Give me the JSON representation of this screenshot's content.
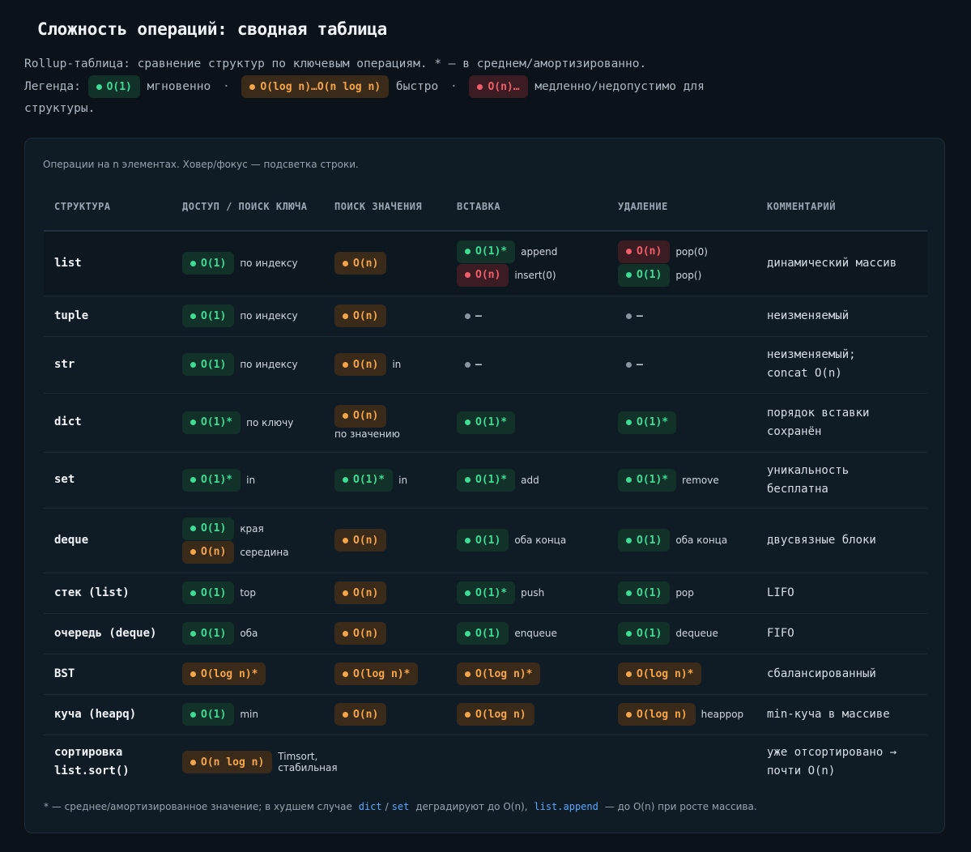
{
  "title": "Сложность операций: сводная таблица",
  "intro": {
    "line1": "Rollup-таблица: сравнение структур по ключевым операциям. * — в среднем/амортизированно.",
    "legend_label": "Легенда:",
    "legend_g": "O(1)",
    "legend_g_text": "мгновенно",
    "legend_sep": "·",
    "legend_o": "O(log n)…O(n log n)",
    "legend_o_text": "быстро",
    "legend_r": "O(n)…",
    "legend_r_text": "медленно/недопустимо для",
    "line3": "структуры."
  },
  "card": {
    "note": "Операции на n элементах. Ховер/фокус — подсветка строки.",
    "headers": [
      "СТРУКТУРА",
      "ДОСТУП / ПОИСК КЛЮЧА",
      "ПОИСК ЗНАЧЕНИЯ",
      "ВСТАВКА",
      "УДАЛЕНИЕ",
      "КОММЕНТАРИЙ"
    ],
    "rows": [
      {
        "name": "list",
        "access": [
          {
            "c": "g",
            "v": "O(1)",
            "n": "по индексу"
          }
        ],
        "search": [
          {
            "c": "o",
            "v": "O(n)",
            "n": ""
          }
        ],
        "insert": [
          {
            "c": "g",
            "v": "O(1)*",
            "n": "append"
          },
          {
            "c": "r",
            "v": "O(n)",
            "n": "insert(0)"
          }
        ],
        "delete": [
          {
            "c": "r",
            "v": "O(n)",
            "n": "pop(0)"
          },
          {
            "c": "g",
            "v": "O(1)",
            "n": "pop()"
          }
        ],
        "comment": "динамический массив",
        "h": 80
      },
      {
        "name": "tuple",
        "access": [
          {
            "c": "g",
            "v": "O(1)",
            "n": "по индексу"
          }
        ],
        "search": [
          {
            "c": "o",
            "v": "O(n)",
            "n": ""
          }
        ],
        "insert": [
          {
            "c": "n",
            "v": "—",
            "n": ""
          }
        ],
        "delete": [
          {
            "c": "n",
            "v": "—",
            "n": ""
          }
        ],
        "comment": "неизменяемый",
        "h": 50
      },
      {
        "name": "str",
        "access": [
          {
            "c": "g",
            "v": "O(1)",
            "n": "по индексу"
          }
        ],
        "search": [
          {
            "c": "o",
            "v": "O(n)",
            "n": "in"
          }
        ],
        "insert": [
          {
            "c": "n",
            "v": "—",
            "n": ""
          }
        ],
        "delete": [
          {
            "c": "n",
            "v": "—",
            "n": ""
          }
        ],
        "comment": "неизменяемый; concat O(n)",
        "h": 70
      },
      {
        "name": "dict",
        "access": [
          {
            "c": "g",
            "v": "O(1)*",
            "n": "по ключу"
          }
        ],
        "search": [
          {
            "c": "o",
            "v": "O(n)",
            "n": "по значению",
            "wrap": true
          }
        ],
        "insert": [
          {
            "c": "g",
            "v": "O(1)*",
            "n": ""
          }
        ],
        "delete": [
          {
            "c": "g",
            "v": "O(1)*",
            "n": ""
          }
        ],
        "comment": "порядок вставки сохранён",
        "h": 73
      },
      {
        "name": "set",
        "access": [
          {
            "c": "g",
            "v": "O(1)*",
            "n": "in"
          }
        ],
        "search": [
          {
            "c": "g",
            "v": "O(1)*",
            "n": "in"
          }
        ],
        "insert": [
          {
            "c": "g",
            "v": "O(1)*",
            "n": "add"
          }
        ],
        "delete": [
          {
            "c": "g",
            "v": "O(1)*",
            "n": "remove"
          }
        ],
        "comment": "уникальность бесплатна",
        "h": 69
      },
      {
        "name": "deque",
        "access": [
          {
            "c": "g",
            "v": "O(1)",
            "n": "края"
          },
          {
            "c": "o",
            "v": "O(n)",
            "n": "середина"
          }
        ],
        "search": [
          {
            "c": "o",
            "v": "O(n)",
            "n": ""
          }
        ],
        "insert": [
          {
            "c": "g",
            "v": "O(1)",
            "n": "оба конца"
          }
        ],
        "delete": [
          {
            "c": "g",
            "v": "O(1)",
            "n": "оба конца"
          }
        ],
        "comment": "двусвязные блоки",
        "h": 80
      },
      {
        "name": "стек (list)",
        "access": [
          {
            "c": "g",
            "v": "O(1)",
            "n": "top"
          }
        ],
        "search": [
          {
            "c": "o",
            "v": "O(n)",
            "n": ""
          }
        ],
        "insert": [
          {
            "c": "g",
            "v": "O(1)*",
            "n": "push"
          }
        ],
        "delete": [
          {
            "c": "g",
            "v": "O(1)",
            "n": "pop"
          }
        ],
        "comment": "LIFO",
        "h": 50
      },
      {
        "name": "очередь (deque)",
        "access": [
          {
            "c": "g",
            "v": "O(1)",
            "n": "оба"
          }
        ],
        "search": [
          {
            "c": "o",
            "v": "O(n)",
            "n": ""
          }
        ],
        "insert": [
          {
            "c": "g",
            "v": "O(1)",
            "n": "enqueue"
          }
        ],
        "delete": [
          {
            "c": "g",
            "v": "O(1)",
            "n": "dequeue"
          }
        ],
        "comment": "FIFO",
        "h": 50
      },
      {
        "name": "BST",
        "access": [
          {
            "c": "o",
            "v": "O(log n)*",
            "n": ""
          }
        ],
        "search": [
          {
            "c": "o",
            "v": "O(log n)*",
            "n": ""
          }
        ],
        "insert": [
          {
            "c": "o",
            "v": "O(log n)*",
            "n": ""
          }
        ],
        "delete": [
          {
            "c": "o",
            "v": "O(log n)*",
            "n": ""
          }
        ],
        "comment": "сбалансированный",
        "h": 50
      },
      {
        "name": "куча (heapq)",
        "access": [
          {
            "c": "g",
            "v": "O(1)",
            "n": "min"
          }
        ],
        "search": [
          {
            "c": "o",
            "v": "O(n)",
            "n": ""
          }
        ],
        "insert": [
          {
            "c": "o",
            "v": "O(log n)",
            "n": ""
          }
        ],
        "delete": [
          {
            "c": "o",
            "v": "O(log n)",
            "n": "heappop"
          }
        ],
        "comment": "min-куча в массиве",
        "h": 50
      },
      {
        "name": "сортировка list.sort()",
        "access": [
          {
            "c": "o",
            "v": "O(n log n)",
            "n": "Timsort, стабильная"
          }
        ],
        "search": [],
        "insert": [],
        "delete": [],
        "comment": "уже отсортировано → почти O(n)",
        "h": 68
      }
    ]
  },
  "footer": {
    "p1": "* — среднее/амортизированное значение; в худшем случае",
    "code1": "dict",
    "slash": "/",
    "code2": "set",
    "p2": "деградируют до O(n),",
    "code3": "list.append",
    "p3": "— до O(n) при росте массива."
  },
  "colors": {
    "good": "#3ddc97",
    "ok": "#f5a64a",
    "bad": "#f25f6b",
    "link": "#5aa9ff",
    "bg": "#0b1219",
    "card": "#0f1b25"
  }
}
